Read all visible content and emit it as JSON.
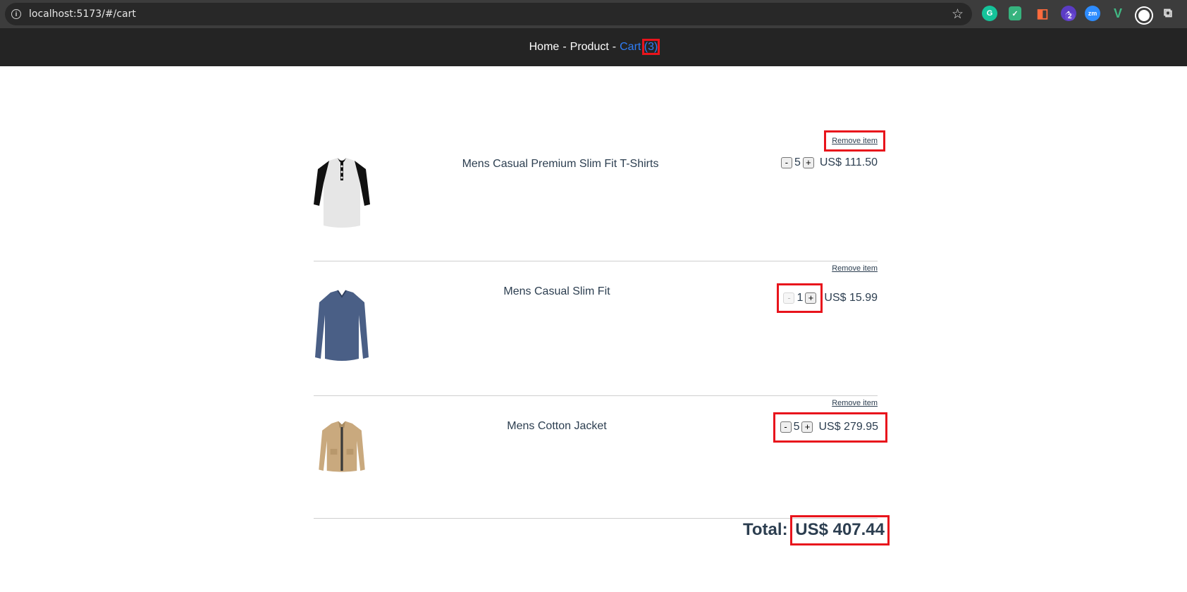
{
  "browser": {
    "url": "localhost:5173/#/cart",
    "extension_badge": "2",
    "zoom_ext_label": "zm"
  },
  "nav": {
    "home": "Home",
    "separator": "-",
    "product": "Product",
    "cart_label": "Cart",
    "cart_count": "(3)"
  },
  "cart": {
    "remove_label": "Remove item",
    "items": [
      {
        "name": "Mens Casual Premium Slim Fit T-Shirts",
        "qty": "5",
        "price": "US$ 111.50",
        "image": "henley-shirt"
      },
      {
        "name": "Mens Casual Slim Fit",
        "qty": "1",
        "price": "US$ 15.99",
        "image": "blue-longsleeve"
      },
      {
        "name": "Mens Cotton Jacket",
        "qty": "5",
        "price": "US$ 279.95",
        "image": "khaki-jacket"
      }
    ],
    "minus": "-",
    "plus": "+",
    "total_label": "Total:",
    "total_value": "US$ 407.44"
  },
  "colors": {
    "highlight": "#e8141c",
    "nav_bg": "#242424",
    "link": "#2f7df6"
  }
}
